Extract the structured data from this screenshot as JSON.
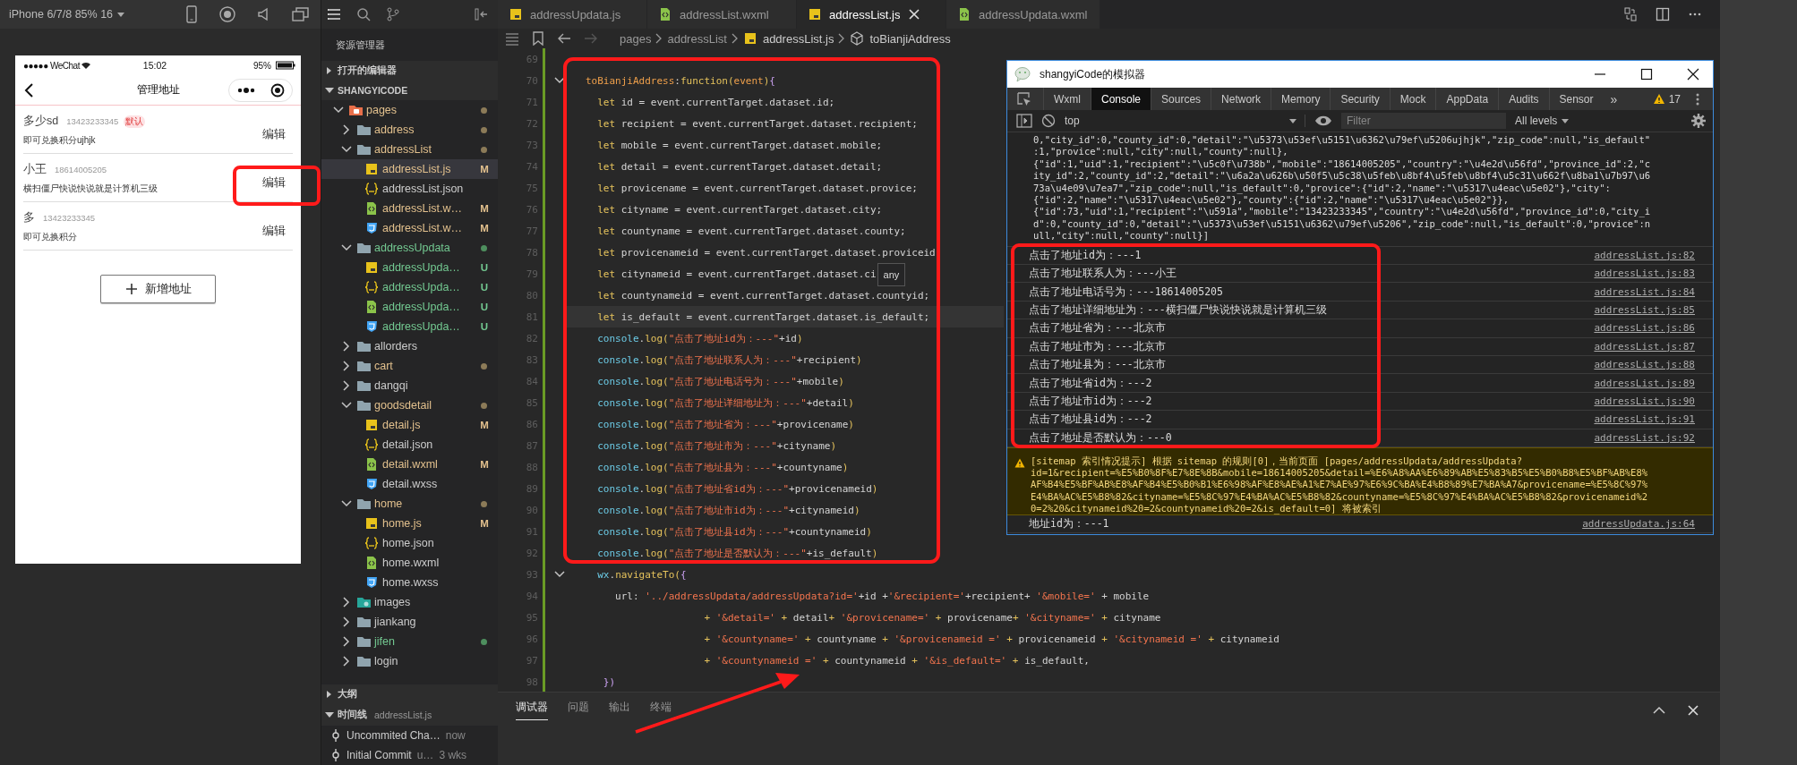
{
  "simulator": {
    "device": "iPhone 6/7/8 85% 16",
    "status_bar": {
      "carrier": "●●●●● WeChat",
      "time": "15:02",
      "battery": "95%"
    },
    "nav_title": "管理地址",
    "addresses": [
      {
        "name": "多少sd",
        "phone": "13423233345",
        "badge": "默认",
        "detail": "即可兑换积分ujhjk",
        "edit": "编辑"
      },
      {
        "name": "小王",
        "phone": "18614005205",
        "detail": "横扫僵尸快说快说就是计算机三级",
        "edit": "编辑"
      },
      {
        "name": "多",
        "phone": "13423233345",
        "detail": "即可兑换积分",
        "edit": "编辑"
      }
    ],
    "add_button": "新增地址"
  },
  "explorer": {
    "title": "资源管理器",
    "open_editors": {
      "label": "打开的编辑器",
      "expanded": false
    },
    "project": {
      "label": "SHANGYICODE",
      "expanded": true
    },
    "tree": [
      {
        "name": "pages",
        "kind": "pages-folder",
        "modified": true,
        "untracked": false,
        "expanded": true,
        "selected": false,
        "children": [
          {
            "name": "address",
            "kind": "folder",
            "modified": true,
            "untracked": false,
            "expanded": false,
            "selected": false
          },
          {
            "name": "addressList",
            "kind": "folder",
            "modified": true,
            "untracked": false,
            "expanded": true,
            "selected": false,
            "children": [
              {
                "name": "addressList.js",
                "kind": "js",
                "modified": true,
                "untracked": false,
                "badge": "M",
                "selected": true
              },
              {
                "name": "addressList.json",
                "kind": "json",
                "modified": false,
                "untracked": false,
                "selected": false
              },
              {
                "name": "addressList.w…",
                "kind": "wxml",
                "modified": true,
                "untracked": false,
                "badge": "M",
                "selected": false
              },
              {
                "name": "addressList.w…",
                "kind": "wxss",
                "modified": true,
                "untracked": false,
                "badge": "M",
                "selected": false
              }
            ]
          },
          {
            "name": "addressUpdata",
            "kind": "folder",
            "modified": false,
            "untracked": true,
            "expanded": true,
            "selected": false,
            "children": [
              {
                "name": "addressUpda…",
                "kind": "js",
                "modified": false,
                "untracked": true,
                "badge": "U",
                "selected": false
              },
              {
                "name": "addressUpda…",
                "kind": "json",
                "modified": false,
                "untracked": true,
                "badge": "U",
                "selected": false
              },
              {
                "name": "addressUpda…",
                "kind": "wxml",
                "modified": false,
                "untracked": true,
                "badge": "U",
                "selected": false
              },
              {
                "name": "addressUpda…",
                "kind": "wxss",
                "modified": false,
                "untracked": true,
                "badge": "U",
                "selected": false
              }
            ]
          },
          {
            "name": "allorders",
            "kind": "folder",
            "modified": false,
            "untracked": false,
            "expanded": false,
            "selected": false
          },
          {
            "name": "cart",
            "kind": "folder",
            "modified": true,
            "untracked": false,
            "expanded": false,
            "selected": false
          },
          {
            "name": "dangqi",
            "kind": "folder",
            "modified": false,
            "untracked": false,
            "expanded": false,
            "selected": false
          },
          {
            "name": "goodsdetail",
            "kind": "folder",
            "modified": true,
            "untracked": false,
            "expanded": true,
            "selected": false,
            "children": [
              {
                "name": "detail.js",
                "kind": "js",
                "modified": true,
                "untracked": false,
                "badge": "M",
                "selected": false
              },
              {
                "name": "detail.json",
                "kind": "json",
                "modified": false,
                "untracked": false,
                "selected": false
              },
              {
                "name": "detail.wxml",
                "kind": "wxml",
                "modified": true,
                "untracked": false,
                "badge": "M",
                "selected": false
              },
              {
                "name": "detail.wxss",
                "kind": "wxss",
                "modified": false,
                "untracked": false,
                "selected": false
              }
            ]
          },
          {
            "name": "home",
            "kind": "folder",
            "modified": true,
            "untracked": false,
            "expanded": true,
            "selected": false,
            "children": [
              {
                "name": "home.js",
                "kind": "js",
                "modified": true,
                "untracked": false,
                "badge": "M",
                "selected": false
              },
              {
                "name": "home.json",
                "kind": "json",
                "modified": false,
                "untracked": false,
                "selected": false
              },
              {
                "name": "home.wxml",
                "kind": "wxml",
                "modified": false,
                "untracked": false,
                "selected": false
              },
              {
                "name": "home.wxss",
                "kind": "wxss",
                "modified": false,
                "untracked": false,
                "selected": false
              }
            ]
          },
          {
            "name": "images",
            "kind": "images-folder",
            "modified": false,
            "untracked": false,
            "expanded": false,
            "selected": false
          },
          {
            "name": "jiankang",
            "kind": "folder",
            "modified": false,
            "untracked": false,
            "expanded": false,
            "selected": false
          },
          {
            "name": "jifen",
            "kind": "folder",
            "modified": false,
            "untracked": true,
            "expanded": false,
            "selected": false
          },
          {
            "name": "login",
            "kind": "folder",
            "modified": false,
            "untracked": false,
            "expanded": false,
            "selected": false
          }
        ]
      }
    ],
    "outline": {
      "label": "大纲",
      "expanded": false
    },
    "timeline": {
      "label": "时间线",
      "expanded": true,
      "file": "addressList.js",
      "entries": [
        {
          "message": "Uncommited Cha…",
          "time": "now"
        },
        {
          "message": "Initial Commit",
          "author": "u…",
          "time": "3 wks"
        }
      ]
    }
  },
  "editor": {
    "tabs": [
      {
        "label": "addressUpdata.js",
        "kind": "js",
        "selected": false
      },
      {
        "label": "addressList.wxml",
        "kind": "wxml",
        "selected": false
      },
      {
        "label": "addressList.js",
        "kind": "js",
        "selected": true
      },
      {
        "label": "addressUpdata.wxml",
        "kind": "wxml",
        "selected": false
      }
    ],
    "breadcrumb": [
      {
        "label": "pages",
        "kind": "folder"
      },
      {
        "label": "addressList",
        "kind": "folder"
      },
      {
        "label": "addressList.js",
        "kind": "js"
      },
      {
        "label": "toBianjiAddress",
        "kind": "method"
      }
    ],
    "tooltip": "any",
    "lines": [
      {
        "number": "69",
        "fold": false,
        "current": false
      },
      {
        "number": "70",
        "fold": true,
        "current": false,
        "tokens": [
          {
            "kind": "fn",
            "text": "toBianjiAddress"
          },
          {
            "kind": "id",
            "text": ":"
          },
          {
            "kind": "kw",
            "text": "function"
          },
          {
            "kind": "paren",
            "text": "("
          },
          {
            "kind": "fn",
            "text": "event"
          },
          {
            "kind": "paren",
            "text": ")"
          },
          {
            "kind": "brace",
            "text": "{"
          }
        ]
      },
      {
        "number": "71",
        "fold": false,
        "current": false,
        "tokens": [
          {
            "kind": "kw",
            "text": "  let"
          },
          {
            "kind": "id",
            "text": " id = event.currentTarget.dataset.id;"
          }
        ]
      },
      {
        "number": "72",
        "fold": false,
        "current": false,
        "tokens": [
          {
            "kind": "kw",
            "text": "  let"
          },
          {
            "kind": "id",
            "text": " recipient = event.currentTarget.dataset.recipient;"
          }
        ]
      },
      {
        "number": "73",
        "fold": false,
        "current": false,
        "tokens": [
          {
            "kind": "kw",
            "text": "  let"
          },
          {
            "kind": "id",
            "text": " mobile = event.currentTarget.dataset.mobile;"
          }
        ]
      },
      {
        "number": "74",
        "fold": false,
        "current": false,
        "tokens": [
          {
            "kind": "kw",
            "text": "  let"
          },
          {
            "kind": "id",
            "text": " detail = event.currentTarget.dataset.detail;"
          }
        ]
      },
      {
        "number": "75",
        "fold": false,
        "current": false,
        "tokens": [
          {
            "kind": "kw",
            "text": "  let"
          },
          {
            "kind": "id",
            "text": " provicename = event.currentTarget.dataset.provice;"
          }
        ]
      },
      {
        "number": "76",
        "fold": false,
        "current": false,
        "tokens": [
          {
            "kind": "kw",
            "text": "  let"
          },
          {
            "kind": "id",
            "text": " cityname = event.currentTarget.dataset.city;"
          }
        ]
      },
      {
        "number": "77",
        "fold": false,
        "current": false,
        "tokens": [
          {
            "kind": "kw",
            "text": "  let"
          },
          {
            "kind": "id",
            "text": " countyname = event.currentTarget.dataset.county;"
          }
        ]
      },
      {
        "number": "78",
        "fold": false,
        "current": false,
        "tokens": [
          {
            "kind": "kw",
            "text": "  let"
          },
          {
            "kind": "id",
            "text": " provicenameid = event.currentTarget.dataset.proviceid"
          }
        ]
      },
      {
        "number": "79",
        "fold": false,
        "current": false,
        "tokens": [
          {
            "kind": "kw",
            "text": "  let"
          },
          {
            "kind": "id",
            "text": " citynameid = event.currentTarget.dataset.ci"
          }
        ]
      },
      {
        "number": "80",
        "fold": false,
        "current": false,
        "tokens": [
          {
            "kind": "kw",
            "text": "  let"
          },
          {
            "kind": "id",
            "text": " countynameid = event.currentTarget.dataset.countyid;"
          }
        ]
      },
      {
        "number": "81",
        "fold": false,
        "current": true,
        "tokens": [
          {
            "kind": "kw",
            "text": "  let"
          },
          {
            "kind": "id",
            "text": " is_default = event.currentTarget.dataset.is_default;"
          }
        ]
      },
      {
        "number": "82",
        "fold": false,
        "current": false,
        "tokens": [
          {
            "kind": "obj",
            "text": "  console"
          },
          {
            "kind": "id",
            "text": "."
          },
          {
            "kind": "kw",
            "text": "log"
          },
          {
            "kind": "paren",
            "text": "("
          },
          {
            "kind": "str",
            "text": "\"点击了地址id为：---\""
          },
          {
            "kind": "id",
            "text": "+id"
          },
          {
            "kind": "paren",
            "text": ")"
          }
        ]
      },
      {
        "number": "83",
        "fold": false,
        "current": false,
        "tokens": [
          {
            "kind": "obj",
            "text": "  console"
          },
          {
            "kind": "id",
            "text": "."
          },
          {
            "kind": "kw",
            "text": "log"
          },
          {
            "kind": "paren",
            "text": "("
          },
          {
            "kind": "str",
            "text": "\"点击了地址联系人为：---\""
          },
          {
            "kind": "id",
            "text": "+recipient"
          },
          {
            "kind": "paren",
            "text": ")"
          }
        ]
      },
      {
        "number": "84",
        "fold": false,
        "current": false,
        "tokens": [
          {
            "kind": "obj",
            "text": "  console"
          },
          {
            "kind": "id",
            "text": "."
          },
          {
            "kind": "kw",
            "text": "log"
          },
          {
            "kind": "paren",
            "text": "("
          },
          {
            "kind": "str",
            "text": "\"点击了地址电话号为：---\""
          },
          {
            "kind": "id",
            "text": "+mobile"
          },
          {
            "kind": "paren",
            "text": ")"
          }
        ]
      },
      {
        "number": "85",
        "fold": false,
        "current": false,
        "tokens": [
          {
            "kind": "obj",
            "text": "  console"
          },
          {
            "kind": "id",
            "text": "."
          },
          {
            "kind": "kw",
            "text": "log"
          },
          {
            "kind": "paren",
            "text": "("
          },
          {
            "kind": "str",
            "text": "\"点击了地址详细地址为：---\""
          },
          {
            "kind": "id",
            "text": "+detail"
          },
          {
            "kind": "paren",
            "text": ")"
          }
        ]
      },
      {
        "number": "86",
        "fold": false,
        "current": false,
        "tokens": [
          {
            "kind": "obj",
            "text": "  console"
          },
          {
            "kind": "id",
            "text": "."
          },
          {
            "kind": "kw",
            "text": "log"
          },
          {
            "kind": "paren",
            "text": "("
          },
          {
            "kind": "str",
            "text": "\"点击了地址省为：---\""
          },
          {
            "kind": "id",
            "text": "+provicename"
          },
          {
            "kind": "paren",
            "text": ")"
          }
        ]
      },
      {
        "number": "87",
        "fold": false,
        "current": false,
        "tokens": [
          {
            "kind": "obj",
            "text": "  console"
          },
          {
            "kind": "id",
            "text": "."
          },
          {
            "kind": "kw",
            "text": "log"
          },
          {
            "kind": "paren",
            "text": "("
          },
          {
            "kind": "str",
            "text": "\"点击了地址市为：---\""
          },
          {
            "kind": "id",
            "text": "+cityname"
          },
          {
            "kind": "paren",
            "text": ")"
          }
        ]
      },
      {
        "number": "88",
        "fold": false,
        "current": false,
        "tokens": [
          {
            "kind": "obj",
            "text": "  console"
          },
          {
            "kind": "id",
            "text": "."
          },
          {
            "kind": "kw",
            "text": "log"
          },
          {
            "kind": "paren",
            "text": "("
          },
          {
            "kind": "str",
            "text": "\"点击了地址县为：---\""
          },
          {
            "kind": "id",
            "text": "+countyname"
          },
          {
            "kind": "paren",
            "text": ")"
          }
        ]
      },
      {
        "number": "89",
        "fold": false,
        "current": false,
        "tokens": [
          {
            "kind": "obj",
            "text": "  console"
          },
          {
            "kind": "id",
            "text": "."
          },
          {
            "kind": "kw",
            "text": "log"
          },
          {
            "kind": "paren",
            "text": "("
          },
          {
            "kind": "str",
            "text": "\"点击了地址省id为：---\""
          },
          {
            "kind": "id",
            "text": "+provicenameid"
          },
          {
            "kind": "paren",
            "text": ")"
          }
        ]
      },
      {
        "number": "90",
        "fold": false,
        "current": false,
        "tokens": [
          {
            "kind": "obj",
            "text": "  console"
          },
          {
            "kind": "id",
            "text": "."
          },
          {
            "kind": "kw",
            "text": "log"
          },
          {
            "kind": "paren",
            "text": "("
          },
          {
            "kind": "str",
            "text": "\"点击了地址市id为：---\""
          },
          {
            "kind": "id",
            "text": "+citynameid"
          },
          {
            "kind": "paren",
            "text": ")"
          }
        ]
      },
      {
        "number": "91",
        "fold": false,
        "current": false,
        "tokens": [
          {
            "kind": "obj",
            "text": "  console"
          },
          {
            "kind": "id",
            "text": "."
          },
          {
            "kind": "kw",
            "text": "log"
          },
          {
            "kind": "paren",
            "text": "("
          },
          {
            "kind": "str",
            "text": "\"点击了地址县id为：---\""
          },
          {
            "kind": "id",
            "text": "+countynameid"
          },
          {
            "kind": "paren",
            "text": ")"
          }
        ]
      },
      {
        "number": "92",
        "fold": false,
        "current": false,
        "tokens": [
          {
            "kind": "obj",
            "text": "  console"
          },
          {
            "kind": "id",
            "text": "."
          },
          {
            "kind": "kw",
            "text": "log"
          },
          {
            "kind": "paren",
            "text": "("
          },
          {
            "kind": "str",
            "text": "\"点击了地址是否默认为：---\""
          },
          {
            "kind": "id",
            "text": "+is_default"
          },
          {
            "kind": "paren",
            "text": ")"
          }
        ]
      },
      {
        "number": "93",
        "fold": true,
        "current": false,
        "tokens": [
          {
            "kind": "obj",
            "text": "  wx"
          },
          {
            "kind": "id",
            "text": "."
          },
          {
            "kind": "kw",
            "text": "navigateTo"
          },
          {
            "kind": "paren",
            "text": "("
          },
          {
            "kind": "brace",
            "text": "{"
          }
        ]
      },
      {
        "number": "94",
        "fold": false,
        "current": false,
        "tokens": [
          {
            "kind": "id",
            "text": "     url: "
          },
          {
            "kind": "str",
            "text": "'../addressUpdata/addressUpdata?id='"
          },
          {
            "kind": "id",
            "text": "+id +"
          },
          {
            "kind": "str",
            "text": "'&recipient='"
          },
          {
            "kind": "id",
            "text": "+recipient+ "
          },
          {
            "kind": "str",
            "text": "'&mobile='"
          },
          {
            "kind": "id",
            "text": " + mobile"
          }
        ]
      },
      {
        "number": "95",
        "fold": false,
        "current": false,
        "tokens": [
          {
            "kind": "op",
            "text": "                    + "
          },
          {
            "kind": "str",
            "text": "'&detail='"
          },
          {
            "kind": "op",
            "text": " + "
          },
          {
            "kind": "id",
            "text": "detail"
          },
          {
            "kind": "op",
            "text": "+ "
          },
          {
            "kind": "str",
            "text": "'&provicename='"
          },
          {
            "kind": "op",
            "text": " + "
          },
          {
            "kind": "id",
            "text": "provicename"
          },
          {
            "kind": "op",
            "text": "+ "
          },
          {
            "kind": "str",
            "text": "'&cityname='"
          },
          {
            "kind": "op",
            "text": " + "
          },
          {
            "kind": "id",
            "text": "cityname"
          }
        ]
      },
      {
        "number": "96",
        "fold": false,
        "current": false,
        "tokens": [
          {
            "kind": "op",
            "text": "                    + "
          },
          {
            "kind": "str",
            "text": "'&countyname='"
          },
          {
            "kind": "op",
            "text": " + "
          },
          {
            "kind": "id",
            "text": "countyname"
          },
          {
            "kind": "op",
            "text": " + "
          },
          {
            "kind": "str",
            "text": "'&provicenameid ='"
          },
          {
            "kind": "op",
            "text": " + "
          },
          {
            "kind": "id",
            "text": "provicenameid"
          },
          {
            "kind": "op",
            "text": " + "
          },
          {
            "kind": "str",
            "text": "'&citynameid ='"
          },
          {
            "kind": "op",
            "text": " + "
          },
          {
            "kind": "id",
            "text": "citynameid"
          }
        ]
      },
      {
        "number": "97",
        "fold": false,
        "current": false,
        "tokens": [
          {
            "kind": "op",
            "text": "                    + "
          },
          {
            "kind": "str",
            "text": "'&countynameid ='"
          },
          {
            "kind": "op",
            "text": " + "
          },
          {
            "kind": "id",
            "text": "countynameid"
          },
          {
            "kind": "op",
            "text": " + "
          },
          {
            "kind": "str",
            "text": "'&is_default='"
          },
          {
            "kind": "op",
            "text": " + "
          },
          {
            "kind": "id",
            "text": "is_default,"
          }
        ]
      },
      {
        "number": "98",
        "fold": false,
        "current": false,
        "tokens": [
          {
            "kind": "brace",
            "text": "   })"
          }
        ]
      }
    ]
  },
  "panel": {
    "tabs": [
      {
        "label": "调试器",
        "selected": true
      },
      {
        "label": "问题",
        "selected": false
      },
      {
        "label": "输出",
        "selected": false
      },
      {
        "label": "终端",
        "selected": false
      }
    ]
  },
  "devtools": {
    "title": "shangyiCode的模拟器",
    "tabs": [
      {
        "label": "Wxml",
        "selected": false
      },
      {
        "label": "Console",
        "selected": true
      },
      {
        "label": "Sources",
        "selected": false
      },
      {
        "label": "Network",
        "selected": false
      },
      {
        "label": "Memory",
        "selected": false
      },
      {
        "label": "Security",
        "selected": false
      },
      {
        "label": "Mock",
        "selected": false
      },
      {
        "label": "AppData",
        "selected": false
      },
      {
        "label": "Audits",
        "selected": false
      },
      {
        "label": "Sensor",
        "selected": false
      }
    ],
    "overflow": "»",
    "warnings": "17",
    "context": "top",
    "filter_placeholder": "Filter",
    "levels": "All levels",
    "entries": [
      {
        "kind": "output",
        "lines": [
          "0,\"city_id\":0,\"county_id\":0,\"detail\":\"\\u5373\\u53ef\\u5151\\u6362\\u79ef\\u5206ujhjk\",\"zip_code\":null,\"is_default\"",
          ":1,\"provice\":null,\"city\":null,\"county\":null},",
          "{\"id\":1,\"uid\":1,\"recipient\":\"\\u5c0f\\u738b\",\"mobile\":\"18614005205\",\"country\":\"\\u4e2d\\u56fd\",\"province_id\":2,\"c",
          "ity_id\":2,\"county_id\":2,\"detail\":\"\\u6a2a\\u626b\\u50f5\\u5c38\\u5feb\\u8bf4\\u5feb\\u8bf4\\u5c31\\u662f\\u8ba1\\u7b97\\u6",
          "73a\\u4e09\\u7ea7\",\"zip_code\":null,\"is_default\":0,\"provice\":{\"id\":2,\"name\":\"\\u5317\\u4eac\\u5e02\"},\"city\":",
          "{\"id\":2,\"name\":\"\\u5317\\u4eac\\u5e02\"},\"county\":{\"id\":2,\"name\":\"\\u5317\\u4eac\\u5e02\"}},",
          "{\"id\":73,\"uid\":1,\"recipient\":\"\\u591a\",\"mobile\":\"13423233345\",\"country\":\"\\u4e2d\\u56fd\",\"province_id\":0,\"city_i",
          "d\":0,\"county_id\":0,\"detail\":\"\\u5373\\u53ef\\u5151\\u6362\\u79ef\\u5206\",\"zip_code\":null,\"is_default\":0,\"provice\":n",
          "ull,\"city\":null,\"county\":null}]"
        ]
      },
      {
        "kind": "log",
        "message": "点击了地址id为：---1",
        "source": "addressList.js:82"
      },
      {
        "kind": "log",
        "message": "点击了地址联系人为：---小王",
        "source": "addressList.js:83"
      },
      {
        "kind": "log",
        "message": "点击了地址电话号为：---18614005205",
        "source": "addressList.js:84"
      },
      {
        "kind": "log",
        "message": "点击了地址详细地址为：---横扫僵尸快说快说就是计算机三级",
        "source": "addressList.js:85"
      },
      {
        "kind": "log",
        "message": "点击了地址省为：---北京市",
        "source": "addressList.js:86"
      },
      {
        "kind": "log",
        "message": "点击了地址市为：---北京市",
        "source": "addressList.js:87"
      },
      {
        "kind": "log",
        "message": "点击了地址县为：---北京市",
        "source": "addressList.js:88"
      },
      {
        "kind": "log",
        "message": "点击了地址省id为：---2",
        "source": "addressList.js:89"
      },
      {
        "kind": "log",
        "message": "点击了地址市id为：---2",
        "source": "addressList.js:90"
      },
      {
        "kind": "log",
        "message": "点击了地址县id为：---2",
        "source": "addressList.js:91"
      },
      {
        "kind": "log",
        "message": "点击了地址是否默认为：---0",
        "source": "addressList.js:92"
      },
      {
        "kind": "warning",
        "lines": [
          "[sitemap 索引情况提示] 根据 sitemap 的规则[0]，当前页面 [pages/addressUpdata/addressUpdata?",
          "id=1&recipient=%E5%B0%8F%E7%8E%8B&mobile=18614005205&detail=%E6%A8%AA%E6%89%AB%E5%83%B5%E5%B0%B8%E5%BF%AB%E8%",
          "AF%B4%E5%BF%AB%E8%AF%B4%E5%B0%B1%E6%98%AF%E8%AE%A1%E7%AE%97%E6%9C%BA%E4%B8%89%E7%BA%A7&provicename=%E5%8C%97%",
          "E4%BA%AC%E5%B8%82&cityname=%E5%8C%97%E4%BA%AC%E5%B8%82&countyname=%E5%8C%97%E4%BA%AC%E5%B8%82&provicenameid%2",
          "0=2%20&citynameid%20=2&countynameid%20=2&is_default=0] 将被索引"
        ]
      },
      {
        "kind": "log",
        "message": "地址id为：---1",
        "source": "addressUpdata.js:64"
      }
    ]
  }
}
